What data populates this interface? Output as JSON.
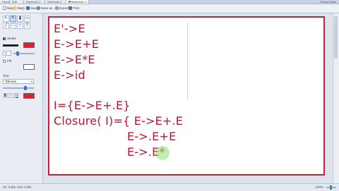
{
  "tabs": [
    {
      "label": "Home",
      "active": false
    },
    {
      "label": "Edit",
      "active": false
    },
    {
      "label": "Notebook 1",
      "active": false
    },
    {
      "label": "Notebook 2",
      "active": false
    },
    {
      "label": "Notebook 3",
      "active": true
    }
  ],
  "window": {
    "right_text": "Share Notes"
  },
  "toolbar": {
    "new_label": "New",
    "open_label": "Open",
    "save_label": "Save",
    "saveas_label": "Save as...",
    "export_label": "Export",
    "print_label": "Print"
  },
  "tools_panel": {
    "stroke_label": "Stroke",
    "stroke_width": "4",
    "stroke_color": "#e0202e",
    "fill_label": "Fill",
    "text_label": "Text",
    "font_name": "Tahoma",
    "bold": "B",
    "italic": "I",
    "underline": "U",
    "text_color": "#e0202e"
  },
  "canvas": {
    "lines": [
      "E'->E",
      "E->E+E",
      "E->E*E",
      "E->id",
      "I={E->E+.E}",
      "Closure( I)={ E->E+.E",
      "E->.E+E",
      "E->.E*"
    ],
    "ink_color": "#b5172e",
    "border_color": "#c4213a"
  },
  "status": {
    "left": "Sz: 0 B/s, Out: 0 B/s",
    "zoom": "100%"
  }
}
